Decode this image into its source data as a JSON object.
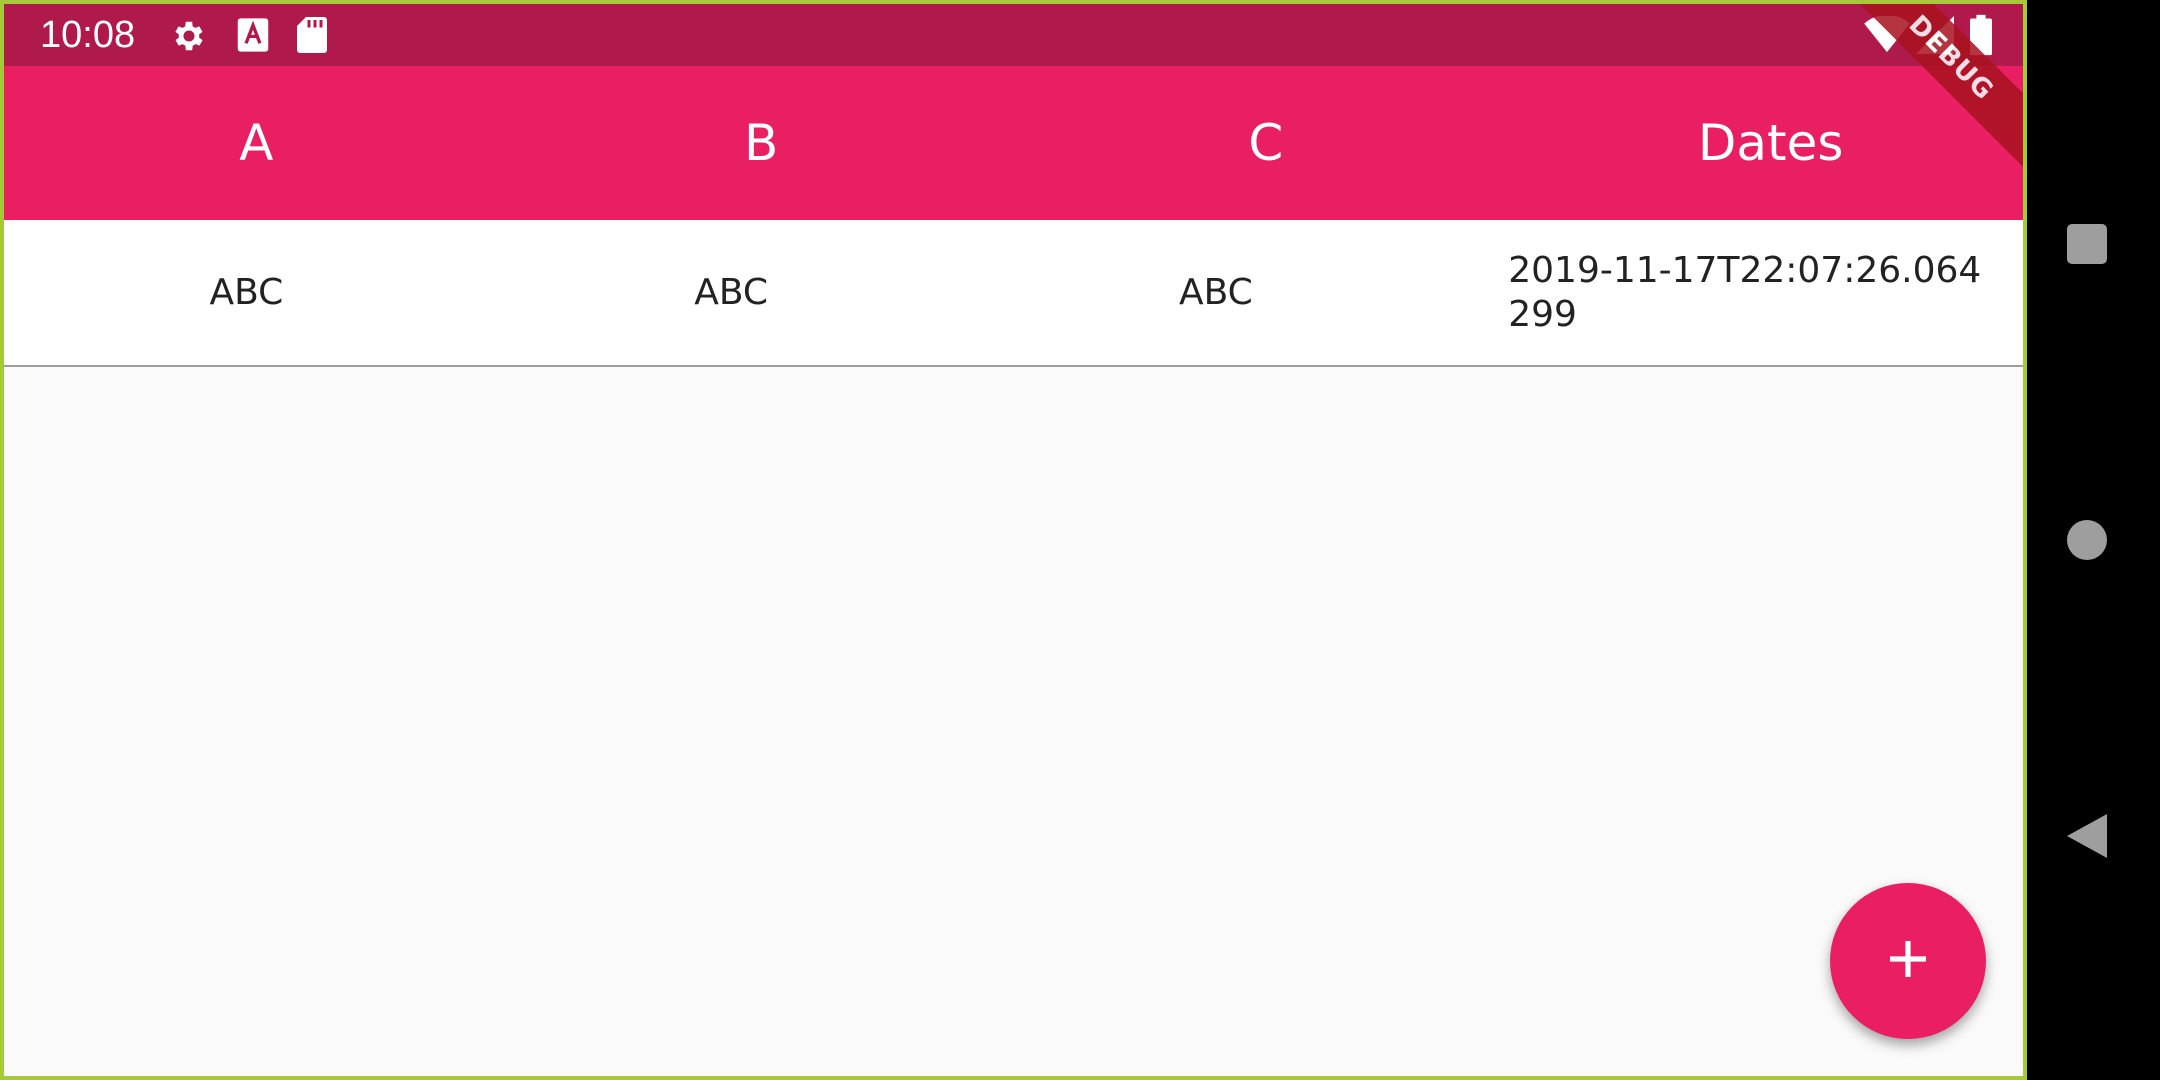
{
  "status_bar": {
    "time": "10:08",
    "icons": [
      "settings-icon",
      "keyboard-a-icon",
      "sd-card-icon",
      "wifi-icon",
      "signal-icon",
      "battery-icon"
    ],
    "color": "#b0194b"
  },
  "debug_banner": "DEBUG",
  "table": {
    "headers": [
      "A",
      "B",
      "C",
      "Dates"
    ],
    "rows": [
      [
        "ABC",
        "ABC",
        "ABC",
        "2019-11-17T22:07:26.064299"
      ]
    ]
  },
  "fab": {
    "icon": "add-icon"
  },
  "nav_bar": {
    "icons": [
      "recents-square-icon",
      "home-circle-icon",
      "back-triangle-icon"
    ]
  },
  "colors": {
    "primary": "#e91e63",
    "primary_dark": "#b0194b",
    "background": "#fafafa",
    "debug": "#a8121e"
  }
}
